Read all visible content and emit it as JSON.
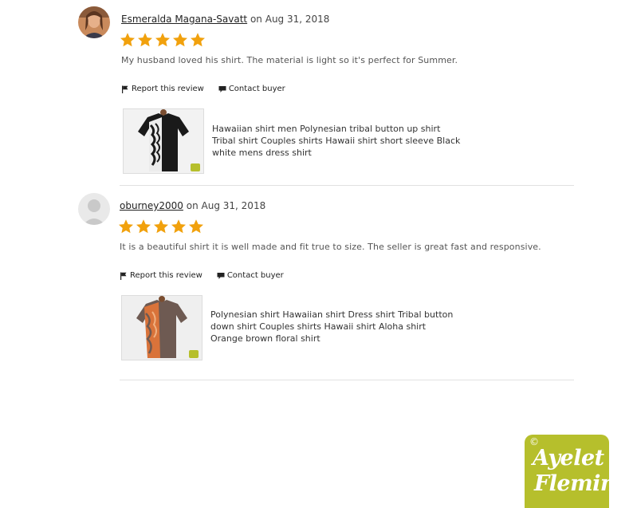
{
  "reviews": [
    {
      "reviewer": "Esmeralda Magana-Savatt",
      "date_prefix": "on",
      "date": "Aug 31, 2018",
      "rating": 5,
      "text": "My husband loved his shirt. The material is light so it's perfect for Summer.",
      "report_label": "Report this review",
      "contact_label": "Contact buyer",
      "product_title": "Hawaiian shirt men Polynesian tribal button up shirt Tribal shirt Couples shirts Hawaii shirt short sleeve Black white mens dress shirt"
    },
    {
      "reviewer": "oburney2000",
      "date_prefix": "on",
      "date": "Aug 31, 2018",
      "rating": 5,
      "text": "It is a beautiful shirt it is well made and fit true to size. The seller is great fast and responsive.",
      "report_label": "Report this review",
      "contact_label": "Contact buyer",
      "product_title": "Polynesian shirt Hawaiian shirt Dress shirt Tribal button down shirt Couples shirts Hawaii shirt Aloha shirt Orange brown floral shirt"
    }
  ],
  "watermark": {
    "copyright": "©",
    "line1": "Ayelet",
    "line2": "Fleming"
  },
  "colors": {
    "star": "#f1a10d",
    "badge": "#b6bf2c"
  },
  "icons": {
    "report": "flag-icon",
    "contact": "message-icon",
    "rating": "star-icon"
  }
}
